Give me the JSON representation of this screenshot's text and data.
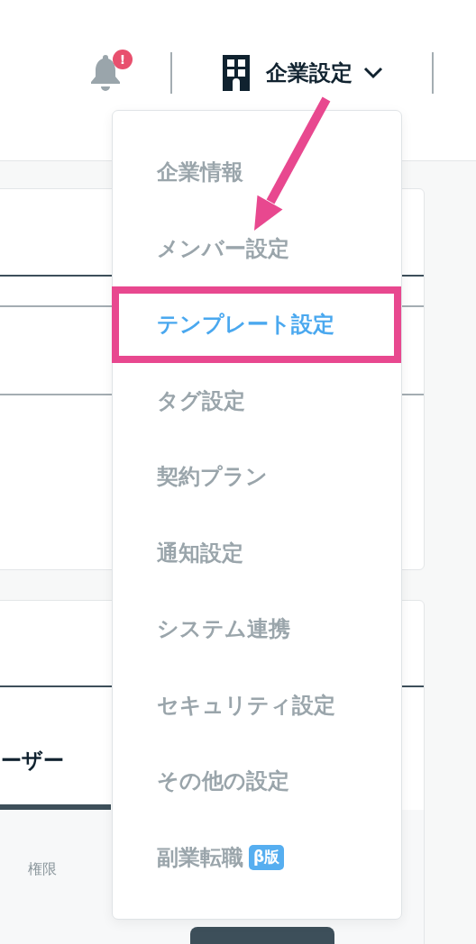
{
  "header": {
    "notification_badge": "!",
    "company_menu": {
      "label": "企業設定",
      "expanded": true
    }
  },
  "dropdown": {
    "items": [
      {
        "label": "企業情報",
        "selected": false,
        "annotated": false
      },
      {
        "label": "メンバー設定",
        "selected": false,
        "annotated": false
      },
      {
        "label": "テンプレート設定",
        "selected": true,
        "annotated": true
      },
      {
        "label": "タグ設定",
        "selected": false,
        "annotated": false
      },
      {
        "label": "契約プラン",
        "selected": false,
        "annotated": false
      },
      {
        "label": "通知設定",
        "selected": false,
        "annotated": false
      },
      {
        "label": "システム連携",
        "selected": false,
        "annotated": false
      },
      {
        "label": "セキュリティ設定",
        "selected": false,
        "annotated": false
      },
      {
        "label": "その他の設定",
        "selected": false,
        "annotated": false
      },
      {
        "label": "副業転職",
        "badge": "β版",
        "selected": false,
        "annotated": false
      }
    ]
  },
  "background": {
    "tab_label": "ーザー",
    "column_header": "権限"
  }
}
